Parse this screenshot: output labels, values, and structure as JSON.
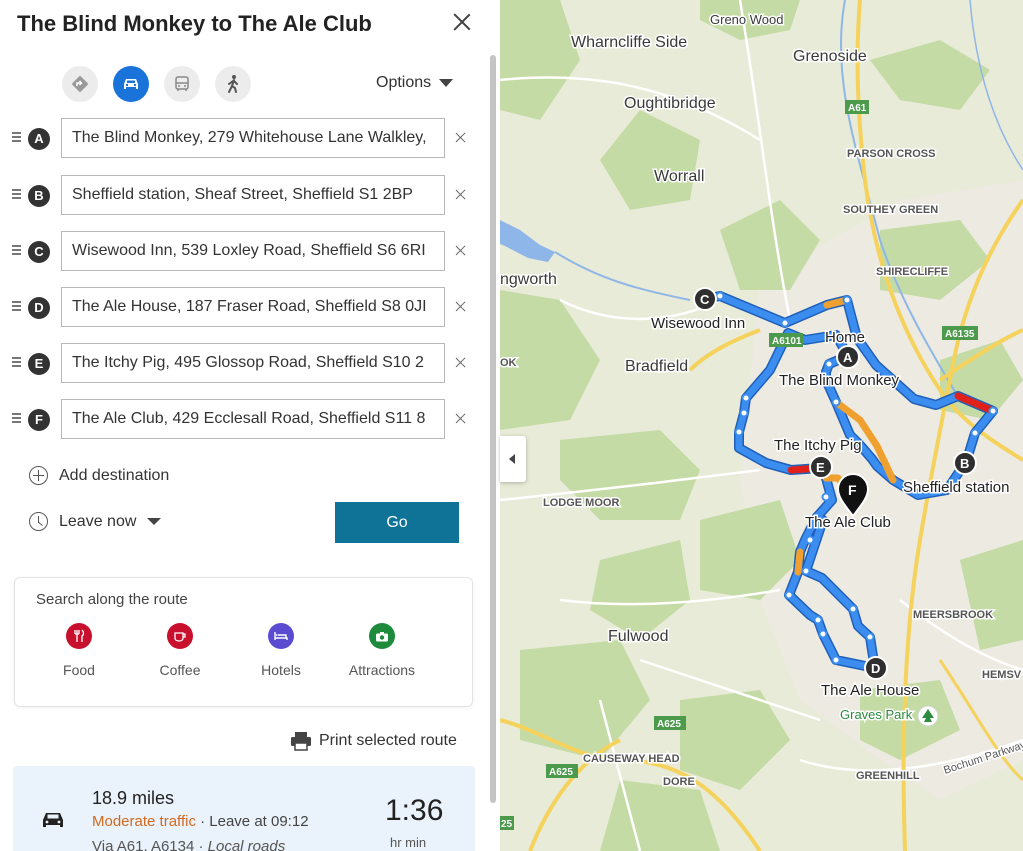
{
  "panel": {
    "title": "The Blind Monkey to The Ale Club",
    "options_label": "Options",
    "modes": [
      {
        "name": "best-route",
        "icon": "route-diamond-icon"
      },
      {
        "name": "driving",
        "icon": "car-icon",
        "active": true
      },
      {
        "name": "transit",
        "icon": "bus-icon"
      },
      {
        "name": "walking",
        "icon": "walking-icon"
      }
    ],
    "waypoints": [
      {
        "letter": "A",
        "value": "The Blind Monkey, 279 Whitehouse Lane Walkley,"
      },
      {
        "letter": "B",
        "value": "Sheffield station, Sheaf Street, Sheffield S1 2BP"
      },
      {
        "letter": "C",
        "value": "Wisewood Inn, 539 Loxley Road, Sheffield S6 6RI"
      },
      {
        "letter": "D",
        "value": "The Ale House, 187 Fraser Road, Sheffield S8 0JI"
      },
      {
        "letter": "E",
        "value": "The Itchy Pig, 495 Glossop Road, Sheffield S10 2"
      },
      {
        "letter": "F",
        "value": "The Ale Club, 429 Ecclesall Road, Sheffield S11 8"
      }
    ],
    "add_destination": "Add destination",
    "leave_now": "Leave now",
    "go_label": "Go",
    "search_along": {
      "title": "Search along the route",
      "categories": [
        {
          "label": "Food",
          "color": "#c8102e",
          "icon": "fork-knife-icon"
        },
        {
          "label": "Coffee",
          "color": "#c8102e",
          "icon": "coffee-cup-icon"
        },
        {
          "label": "Hotels",
          "color": "#5a4bd1",
          "icon": "bed-icon"
        },
        {
          "label": "Attractions",
          "color": "#1e8a3c",
          "icon": "camera-icon"
        }
      ]
    },
    "print_label": "Print selected route",
    "route_summary": {
      "distance": "18.9 miles",
      "traffic": "Moderate traffic",
      "leave_at": " · Leave at 09:12",
      "via": "Via A61, A6134 · ",
      "via_local": "Local roads",
      "duration": "1:36",
      "duration_unit": "hr min"
    }
  },
  "map": {
    "colors": {
      "route": "#2a7be4",
      "moderate": "#f0a02e",
      "heavy": "#e0211a",
      "motorway": "#f5d25c"
    },
    "places": [
      "Greno Wood",
      "Wharncliffe Side",
      "Grenoside",
      "Oughtibridge",
      "PARSON CROSS",
      "Worrall",
      "SOUTHEY GREEN",
      "SHIRECLIFFE",
      "ngworth",
      "Bradfield",
      "LODGE MOOR",
      "MEERSBROOK",
      "Fulwood",
      "Graves Park",
      "CAUSEWAY HEAD",
      "DORE",
      "GREENHILL",
      "HEMSV",
      "Bochum Parkway",
      "OK"
    ],
    "road_labels": [
      "A61",
      "A6101",
      "A6135",
      "A625",
      "A625",
      "25"
    ],
    "pins": [
      {
        "letter": "A",
        "label": "The Blind Monkey"
      },
      {
        "letter": "B",
        "label": "Sheffield station"
      },
      {
        "letter": "C",
        "label": "Wisewood Inn"
      },
      {
        "letter": "D",
        "label": "The Ale House"
      },
      {
        "letter": "E",
        "label": "The Itchy Pig"
      },
      {
        "letter": "F",
        "label": "The Ale Club"
      }
    ],
    "home_label": "Home"
  }
}
